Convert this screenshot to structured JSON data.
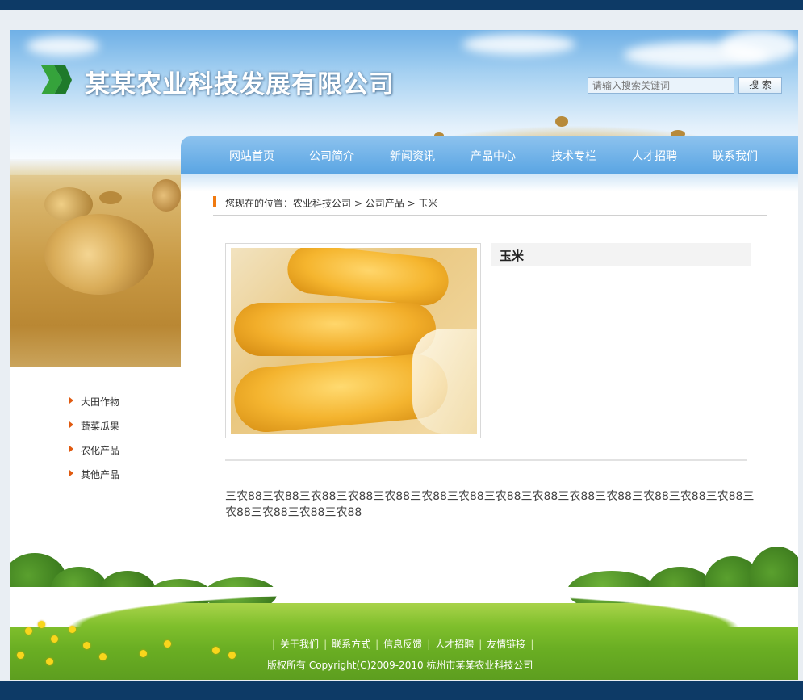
{
  "header": {
    "company_name": "某某农业科技发展有限公司",
    "search": {
      "placeholder": "请输入搜索关键词",
      "button_label": "搜 索"
    }
  },
  "nav": {
    "items": [
      "网站首页",
      "公司简介",
      "新闻资讯",
      "产品中心",
      "技术专栏",
      "人才招聘",
      "联系我们"
    ]
  },
  "sidebar": {
    "items": [
      "大田作物",
      "蔬菜瓜果",
      "农化产品",
      "其他产品"
    ]
  },
  "breadcrumb": {
    "prefix": "您现在的位置：",
    "path": [
      "农业科技公司",
      "> 公司产品",
      "> 玉米"
    ]
  },
  "product": {
    "title": "玉米",
    "description": "三农88三农88三农88三农88三农88三农88三农88三农88三农88三农88三农88三农88三农88三农88三农88三农88三农88三农88"
  },
  "footer": {
    "links": [
      "关于我们",
      "联系方式",
      "信息反馈",
      "人才招聘",
      "友情链接"
    ],
    "copyright": "版权所有  Copyright(C)2009-2010 杭州市某某农业科技公司"
  },
  "colors": {
    "nav_blue": "#5aa5e3",
    "accent_orange": "#f07a10",
    "frame_navy": "#0d3a66"
  }
}
